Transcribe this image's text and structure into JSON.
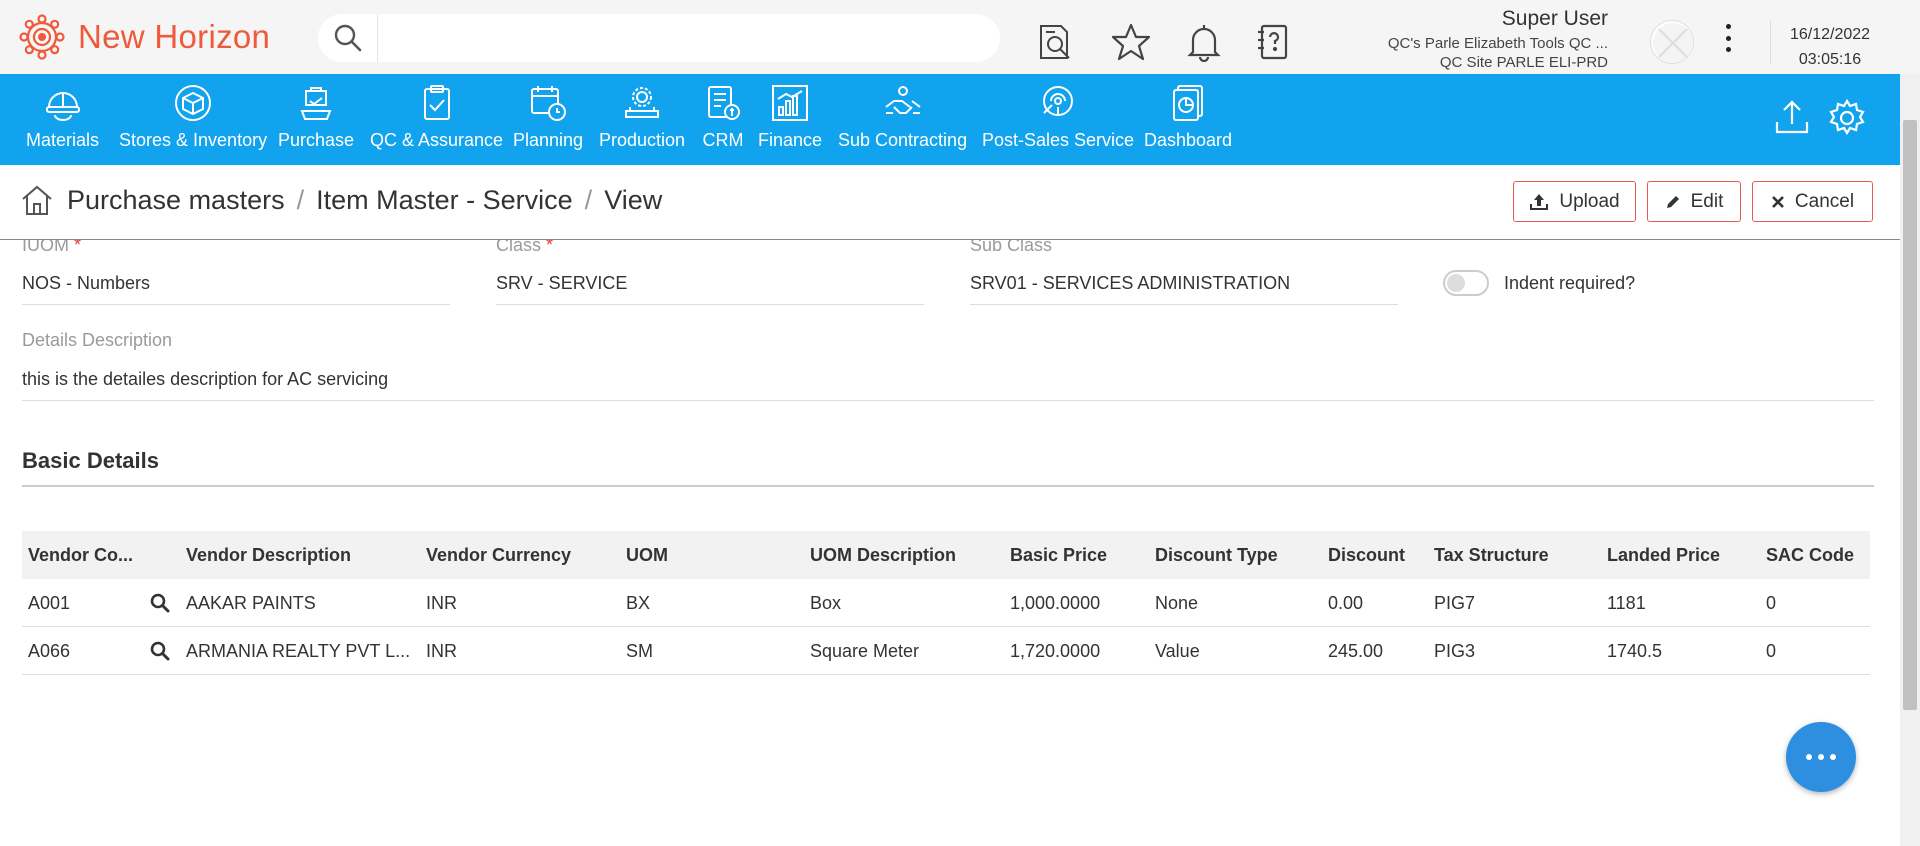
{
  "app": {
    "title": "New Horizon"
  },
  "search": {
    "placeholder": ""
  },
  "user": {
    "name": "Super User",
    "company": "QC's Parle Elizabeth Tools QC ...",
    "site": "QC Site PARLE ELI-PRD"
  },
  "datetime": {
    "date": "16/12/2022",
    "time": "03:05:16"
  },
  "nav": {
    "items": [
      {
        "label": "Materials",
        "icon": "helmet-icon"
      },
      {
        "label": "Stores & Inventory",
        "icon": "box-icon"
      },
      {
        "label": "Purchase",
        "icon": "cart-icon"
      },
      {
        "label": "QC & Assurance",
        "icon": "clipboard-check-icon"
      },
      {
        "label": "Planning",
        "icon": "calendar-clock-icon"
      },
      {
        "label": "Production",
        "icon": "factory-gear-icon"
      },
      {
        "label": "CRM",
        "icon": "crm-icon"
      },
      {
        "label": "Finance",
        "icon": "bar-chart-icon"
      },
      {
        "label": "Sub Contracting",
        "icon": "handshake-icon"
      },
      {
        "label": "Post-Sales Service",
        "icon": "service-icon"
      },
      {
        "label": "Dashboard",
        "icon": "dashboard-icon"
      }
    ]
  },
  "breadcrumb": {
    "items": [
      "Purchase masters",
      "Item Master - Service",
      "View"
    ],
    "separator": "/"
  },
  "actions": {
    "upload": "Upload",
    "edit": "Edit",
    "cancel": "Cancel"
  },
  "form": {
    "uom": {
      "label": "IUOM",
      "value": "NOS - Numbers"
    },
    "class": {
      "label": "Class",
      "value": "SRV - SERVICE"
    },
    "sub_class": {
      "label": "Sub Class",
      "value": "SRV01 - SERVICES ADMINISTRATION"
    },
    "indent_required": {
      "label": "Indent required?",
      "on": false
    },
    "details_description": {
      "label": "Details Description",
      "value": "this is the detailes description for AC servicing"
    }
  },
  "basic_details": {
    "title": "Basic Details",
    "columns": [
      "Vendor Co...",
      "Vendor Description",
      "Vendor Currency",
      "UOM",
      "UOM Description",
      "Basic Price",
      "Discount Type",
      "Discount",
      "Tax Structure",
      "Landed Price",
      "SAC Code"
    ],
    "rows": [
      [
        "A001",
        "AAKAR PAINTS",
        "INR",
        "BX",
        "Box",
        "1,000.0000",
        "None",
        "0.00",
        "PIG7",
        "1181",
        "0"
      ],
      [
        "A066",
        "ARMANIA REALTY PVT L...",
        "INR",
        "SM",
        "Square Meter",
        "1,720.0000",
        "Value",
        "245.00",
        "PIG3",
        "1740.5",
        "0"
      ]
    ]
  },
  "colors": {
    "brand": "#f05a3c",
    "nav_bg": "#12a3ee",
    "action_border": "#e65c4f",
    "chat": "#2e8fe0"
  }
}
